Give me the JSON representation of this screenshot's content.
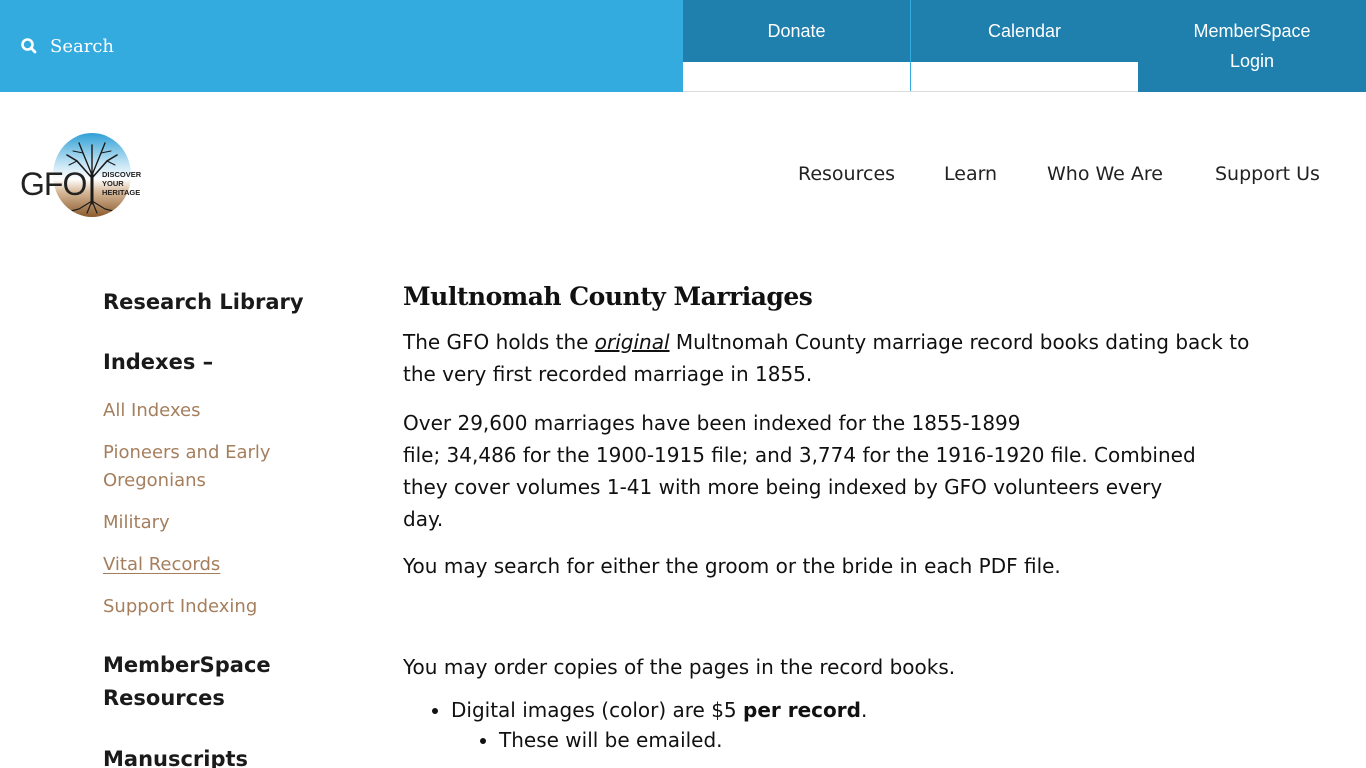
{
  "topbar": {
    "search_label": "Search",
    "buttons": {
      "donate": "Donate",
      "calendar": "Calendar",
      "login_line1": "MemberSpace",
      "login_line2": "Login"
    },
    "colors": {
      "search_bg": "#33abdf",
      "button_bg": "#1f7fad"
    }
  },
  "logo": {
    "text": "GFO",
    "tagline": [
      "DISCOVER",
      "YOUR",
      "HERITAGE"
    ]
  },
  "nav": {
    "items": [
      "Resources",
      "Learn",
      "Who We Are",
      "Support Us"
    ]
  },
  "sidebar": {
    "research_library": "Research Library",
    "indexes": "Indexes –",
    "index_links": [
      {
        "label": "All Indexes",
        "active": false
      },
      {
        "label": "Pioneers and Early Oregonians",
        "active": false
      },
      {
        "label": "Military",
        "active": false
      },
      {
        "label": "Vital Records",
        "active": true
      },
      {
        "label": "Support Indexing",
        "active": false
      }
    ],
    "memberspace_resources": "MemberSpace Resources",
    "manuscripts": "Manuscripts",
    "link_color": "#a57f5d"
  },
  "content": {
    "title": "Multnomah County Marriages",
    "p1_before": "The GFO holds the ",
    "p1_em": "original",
    "p1_after": " Multnomah County marriage record books dating back to the very first recorded marriage in 1855.",
    "p2_line1": "Over 29,600 marriages have been indexed for the 1855-1899",
    "p2_rest": "file; 34,486 for the 1900-1915 file; and 3,774 for the 1916-1920 file. Combined they cover volumes 1-41 with more being indexed by GFO volunteers every day.",
    "p3": "You may search for either the groom or the bride in each PDF file.",
    "p4": "You may order copies of the pages in the record books.",
    "bullet1_before": "Digital images (color) are $5 ",
    "bullet1_bold": "per record",
    "bullet1_after": ".",
    "sub_bullet1": "These will be emailed."
  }
}
